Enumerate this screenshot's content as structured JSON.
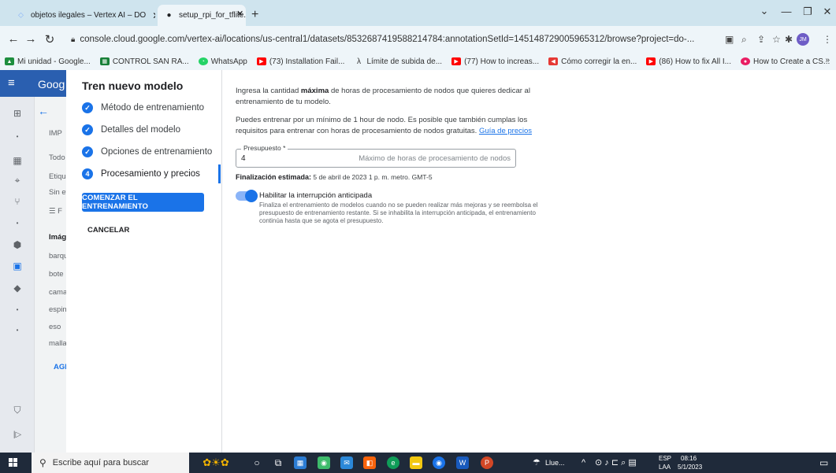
{
  "browser": {
    "tabs": [
      {
        "title": "objetos ilegales – Vertex AI – DO",
        "active": false
      },
      {
        "title": "setup_rpi_for_tflite.sh · GitHub",
        "active": true
      }
    ],
    "url": "console.cloud.google.com/vertex-ai/locations/us-central1/datasets/8532687419588214784:annotationSetId=145148729005965312/browse?project=do-...",
    "profile_initials": "JM",
    "bookmarks": [
      {
        "label": "Mi unidad - Google...",
        "color": "#1e8e3e"
      },
      {
        "label": "CONTROL SAN RA...",
        "color": "#188038"
      },
      {
        "label": "WhatsApp",
        "color": "#25d366"
      },
      {
        "label": "(73) Installation Fail...",
        "color": "#ff0000"
      },
      {
        "label": "Límite de subida de...",
        "color": "#333333"
      },
      {
        "label": "(77) How to increas...",
        "color": "#ff0000"
      },
      {
        "label": "Cómo corregir la en...",
        "color": "#e53935"
      },
      {
        "label": "(86) How to fix All I...",
        "color": "#ff0000"
      },
      {
        "label": "How to Create a CS...",
        "color": "#e91e63"
      }
    ]
  },
  "background_page": {
    "header": "Goog",
    "texts": [
      "IMP",
      "Todo",
      "Etiqu",
      "Sin et",
      "Imág",
      "barqu",
      "bote",
      "cama",
      "espin",
      "eso",
      "malla",
      "AGI"
    ]
  },
  "stepper": {
    "title": "Tren nuevo modelo",
    "steps": [
      {
        "label": "Método de entrenamiento",
        "marker": "✓"
      },
      {
        "label": "Detalles del modelo",
        "marker": "✓"
      },
      {
        "label": "Opciones de entrenamiento",
        "marker": "✓"
      },
      {
        "label": "Procesamiento y precios",
        "marker": "4"
      }
    ],
    "start_button": "COMENZAR EL ENTRENAMIENTO",
    "cancel_button": "CANCELAR"
  },
  "main": {
    "intro_pre": "Ingresa la cantidad ",
    "intro_bold": "máxima",
    "intro_post": " de horas de procesamiento de nodos que quieres dedicar al entrenamiento de tu modelo.",
    "minimum_text": "Puedes entrenar por un mínimo de 1 hour de nodo. Es posible que también cumplas los requisitos para entrenar con horas de procesamiento de nodos gratuitas.",
    "pricing_link": "Guía de precios",
    "budget_label": "Presupuesto *",
    "budget_value": "4",
    "budget_hint": "Máximo de horas de procesamiento de nodos",
    "finish_label": "Finalización estimada:",
    "finish_value": "5 de abril de 2023 1 p. m. metro. GMT-5",
    "early_stop_label": "Habilitar la interrupción anticipada",
    "early_stop_enabled": true,
    "early_stop_desc": "Finaliza el entrenamiento de modelos cuando no se pueden realizar más mejoras y se reembolsa el presupuesto de entrenamiento restante. Si se inhabilita la interrupción anticipada, el entrenamiento continúa hasta que se agota el presupuesto."
  },
  "taskbar": {
    "search_placeholder": "Escribe aquí para buscar",
    "weather": "Llue...",
    "lang_top": "ESP",
    "lang_bottom": "LAA",
    "time": "08:16",
    "date": "5/1/2023"
  }
}
